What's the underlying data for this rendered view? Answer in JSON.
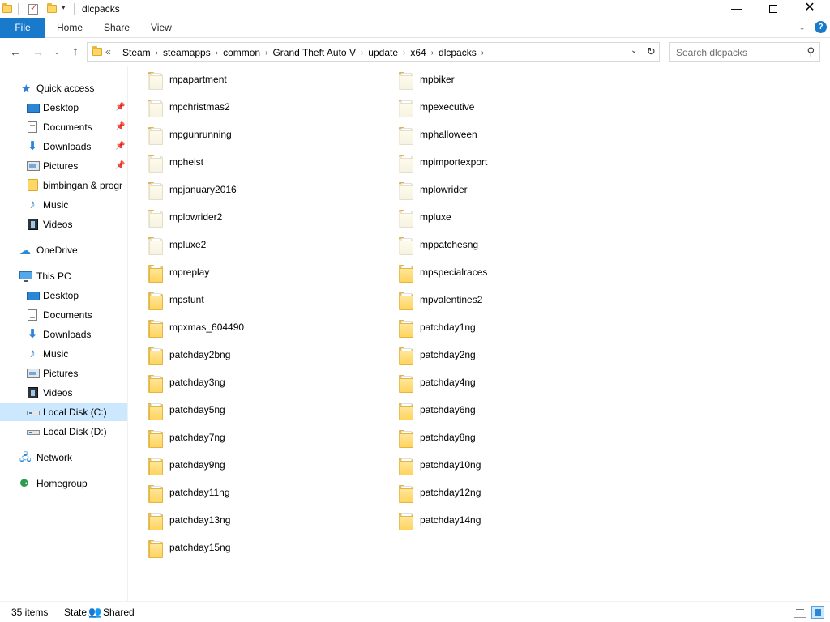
{
  "window": {
    "title": "dlcpacks",
    "minimize_glyph": "—",
    "close_glyph": "✕"
  },
  "ribbon": {
    "tabs": [
      "File",
      "Home",
      "Share",
      "View"
    ],
    "collapse_glyph": "⌄",
    "help_glyph": "?"
  },
  "nav": {
    "back_glyph": "←",
    "forward_glyph": "→",
    "recent_glyph": "⌄",
    "up_glyph": "↑"
  },
  "address": {
    "overflow": "«",
    "crumbs": [
      "Steam",
      "steamapps",
      "common",
      "Grand Theft Auto V",
      "update",
      "x64",
      "dlcpacks"
    ],
    "separator": "›",
    "dropdown_glyph": "⌄",
    "refresh_glyph": "↻"
  },
  "search": {
    "placeholder": "Search dlcpacks",
    "icon_glyph": "⚲"
  },
  "sidebar": {
    "quick_access": "Quick access",
    "quick_items": [
      "Desktop",
      "Documents",
      "Downloads",
      "Pictures",
      "bimbingan & progr",
      "Music",
      "Videos"
    ],
    "onedrive": "OneDrive",
    "this_pc": "This PC",
    "pc_items": [
      "Desktop",
      "Documents",
      "Downloads",
      "Music",
      "Pictures",
      "Videos",
      "Local Disk (C:)",
      "Local Disk (D:)"
    ],
    "network": "Network",
    "homegroup": "Homegroup",
    "pin_glyph": "📌",
    "star_glyph": "★",
    "down_glyph": "⬇",
    "music_glyph": "♪",
    "cloud_glyph": "☁",
    "net_glyph": "🖧",
    "home_glyph": "⚈"
  },
  "folders": {
    "left": [
      {
        "name": "mpapartment",
        "empty": true
      },
      {
        "name": "mpchristmas2",
        "empty": true
      },
      {
        "name": "mpgunrunning",
        "empty": true
      },
      {
        "name": "mpheist",
        "empty": true
      },
      {
        "name": "mpjanuary2016",
        "empty": true
      },
      {
        "name": "mplowrider2",
        "empty": true
      },
      {
        "name": "mpluxe2",
        "empty": true
      },
      {
        "name": "mpreplay",
        "empty": false
      },
      {
        "name": "mpstunt",
        "empty": false
      },
      {
        "name": "mpxmas_604490",
        "empty": false
      },
      {
        "name": "patchday2bng",
        "empty": false
      },
      {
        "name": "patchday3ng",
        "empty": false
      },
      {
        "name": "patchday5ng",
        "empty": false
      },
      {
        "name": "patchday7ng",
        "empty": false
      },
      {
        "name": "patchday9ng",
        "empty": false
      },
      {
        "name": "patchday11ng",
        "empty": false
      },
      {
        "name": "patchday13ng",
        "empty": false
      },
      {
        "name": "patchday15ng",
        "empty": false
      }
    ],
    "right": [
      {
        "name": "mpbiker",
        "empty": true
      },
      {
        "name": "mpexecutive",
        "empty": true
      },
      {
        "name": "mphalloween",
        "empty": true
      },
      {
        "name": "mpimportexport",
        "empty": true
      },
      {
        "name": "mplowrider",
        "empty": true
      },
      {
        "name": "mpluxe",
        "empty": true
      },
      {
        "name": "mppatchesng",
        "empty": true
      },
      {
        "name": "mpspecialraces",
        "empty": false
      },
      {
        "name": "mpvalentines2",
        "empty": false
      },
      {
        "name": "patchday1ng",
        "empty": false
      },
      {
        "name": "patchday2ng",
        "empty": false
      },
      {
        "name": "patchday4ng",
        "empty": false
      },
      {
        "name": "patchday6ng",
        "empty": false
      },
      {
        "name": "patchday8ng",
        "empty": false
      },
      {
        "name": "patchday10ng",
        "empty": false
      },
      {
        "name": "patchday12ng",
        "empty": false
      },
      {
        "name": "patchday14ng",
        "empty": false
      }
    ]
  },
  "status": {
    "count": "35 items",
    "state_label": "State:",
    "shared_glyph": "👥",
    "shared": "Shared"
  },
  "colors": {
    "accent": "#1979ca",
    "selection": "#cce8ff",
    "folder": "#ffd766"
  }
}
